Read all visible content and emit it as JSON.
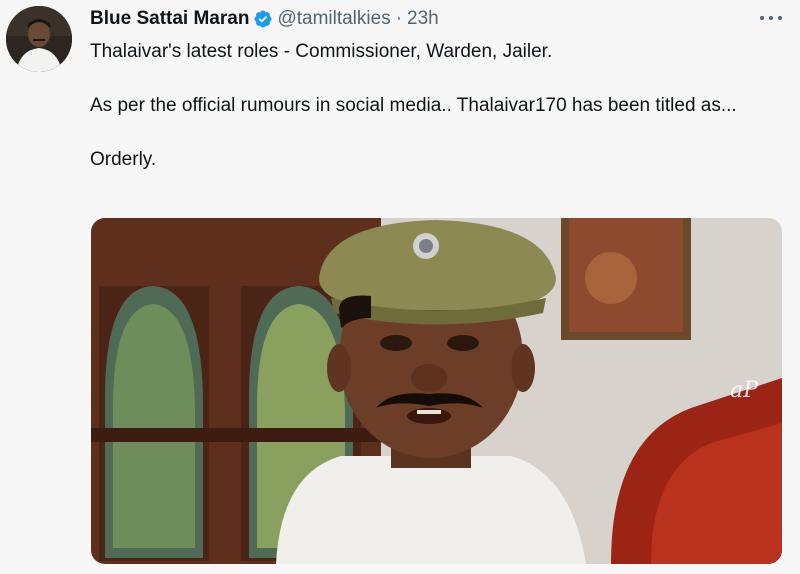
{
  "tweet": {
    "author_name": "Blue Sattai Maran",
    "handle": "@tamiltalkies",
    "separator": "·",
    "timestamp": "23h",
    "verified": true,
    "body": "Thalaivar's latest roles - Commissioner, Warden, Jailer.\n\nAs per the official rumours in social media.. Thalaivar170 has been titled as...\n\nOrderly.",
    "media_watermark": "aP"
  },
  "icons": {
    "verified": "verified-badge-icon",
    "more": "more-options-icon"
  },
  "colors": {
    "verified_blue": "#1d9bf0",
    "secondary_text": "#536471"
  }
}
